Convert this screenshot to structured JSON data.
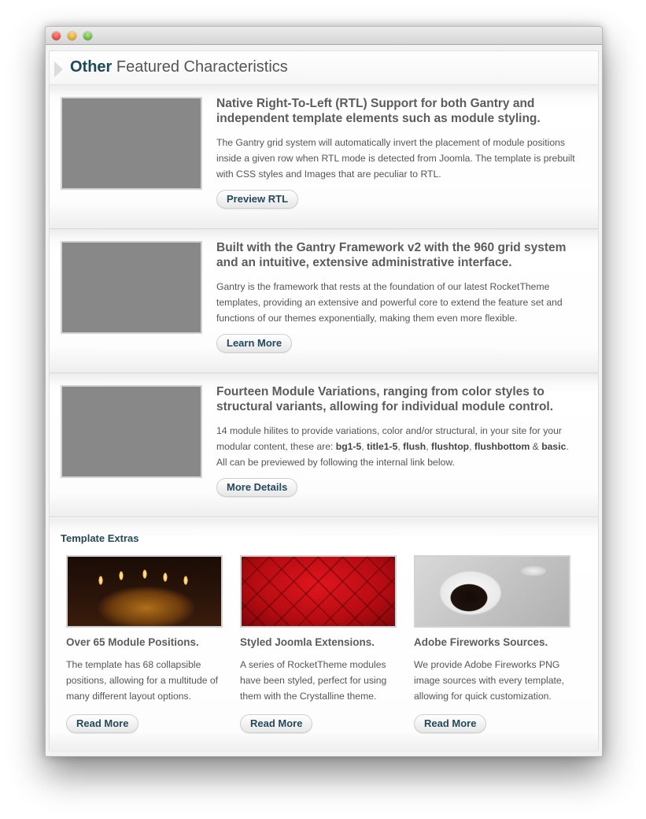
{
  "window": {
    "controls": [
      "close",
      "minimize",
      "zoom"
    ]
  },
  "section": {
    "title_accent": "Other",
    "title_rest": " Featured Characteristics"
  },
  "features": [
    {
      "title": "Native Right-To-Left (RTL) Support for both Gantry and independent template elements such as module styling.",
      "text": "The Gantry grid system will automatically invert the placement of module positions inside a given row when RTL mode is detected from Joomla. The template is prebuilt with CSS styles and Images that are peculiar to RTL.",
      "button": "Preview RTL",
      "image": "balanced-stones-photo"
    },
    {
      "title": "Built with the Gantry Framework v2 with the 960 grid system and an intuitive, extensive administrative interface.",
      "text": "Gantry is the framework that rests at the foundation of our latest RocketTheme templates, providing an extensive and powerful core to extend the feature set and functions of our themes exponentially, making them even more flexible.",
      "button": "Learn More",
      "image": "leaf-water-drops-photo"
    },
    {
      "title": "Fourteen Module Variations, ranging from color styles to structural variants, allowing for individual module control.",
      "text_parts": [
        "14 module hilites to provide variations, color and/or structural, in your site for your modular content, these are: ",
        "bg1-5",
        ", ",
        "title1-5",
        ", ",
        "flush",
        ", ",
        "flushtop",
        ", ",
        "flushbottom",
        " & ",
        "basic",
        ". All can be previewed by following the internal link below."
      ],
      "button": "More Details",
      "image": "sneakers-photo"
    }
  ],
  "extras": {
    "title": "Template Extras",
    "items": [
      {
        "title": "Over 65 Module Positions.",
        "text": "The template has 68 collapsible positions, allowing for a multitude of many different layout options.",
        "button": "Read More",
        "image": "candles-photo"
      },
      {
        "title": "Styled Joomla Extensions.",
        "text": "A series of RocketTheme modules have been styled, perfect for using them with the Crystalline theme.",
        "button": "Read More",
        "image": "red-tufted-leather-photo"
      },
      {
        "title": "Adobe Fireworks Sources.",
        "text": "We provide Adobe Fireworks PNG image sources with every template, allowing for quick customization.",
        "button": "Read More",
        "image": "coffee-cup-photo"
      }
    ]
  },
  "colors": {
    "accent": "#1d4a5a",
    "text": "#555555",
    "heading": "#5c5c5c"
  }
}
